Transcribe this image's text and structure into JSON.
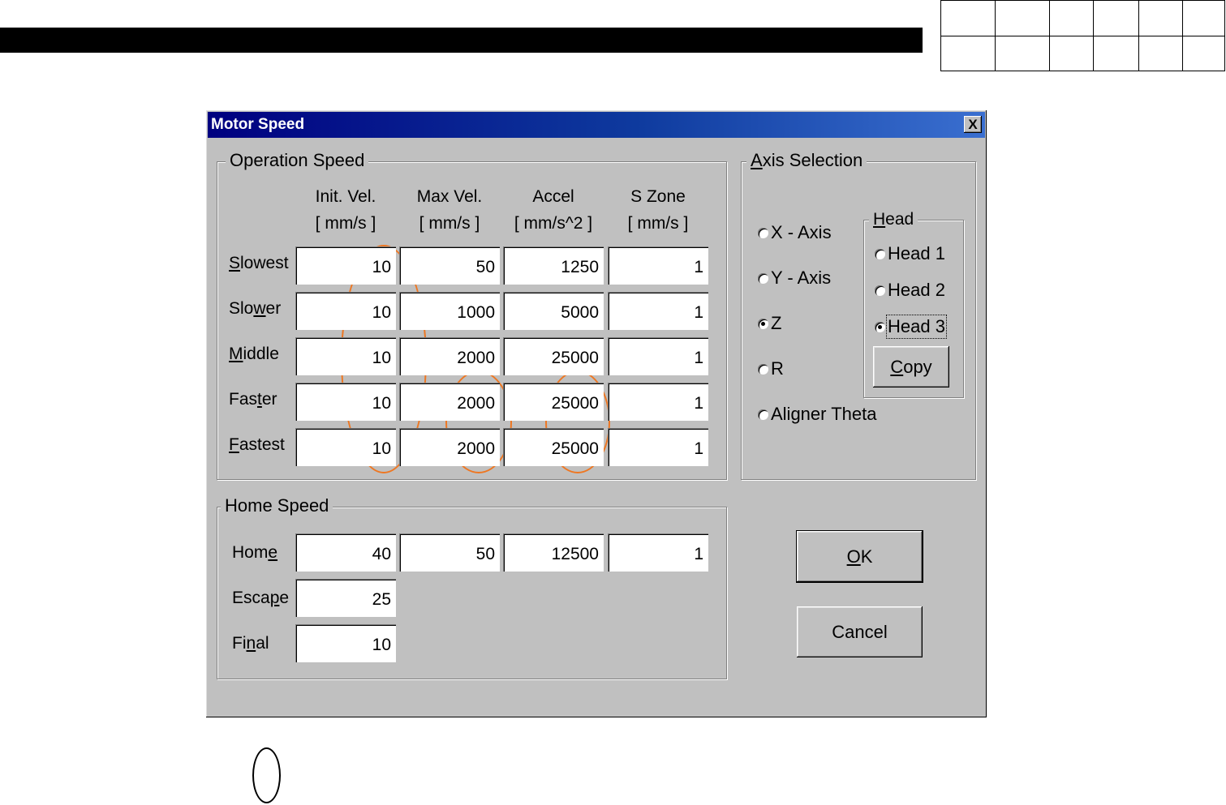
{
  "dialog": {
    "title": "Motor Speed",
    "close_label": "X"
  },
  "operation": {
    "group_label": "Operation Speed",
    "headers": [
      {
        "line1": "Init. Vel.",
        "line2": "[ mm/s ]"
      },
      {
        "line1": "Max Vel.",
        "line2": "[ mm/s ]"
      },
      {
        "line1": "Accel",
        "line2": "[ mm/s^2 ]"
      },
      {
        "line1": "S Zone",
        "line2": "[ mm/s ]"
      }
    ],
    "rows": [
      {
        "label": "Slowest",
        "mnemonic": "S",
        "values": [
          "10",
          "50",
          "1250",
          "1"
        ]
      },
      {
        "label": "Slower",
        "mnemonic": "w",
        "values": [
          "10",
          "1000",
          "5000",
          "1"
        ]
      },
      {
        "label": "Middle",
        "mnemonic": "M",
        "values": [
          "10",
          "2000",
          "25000",
          "1"
        ]
      },
      {
        "label": "Faster",
        "mnemonic": "t",
        "values": [
          "10",
          "2000",
          "25000",
          "1"
        ]
      },
      {
        "label": "Fastest",
        "mnemonic": "F",
        "values": [
          "10",
          "2000",
          "25000",
          "1"
        ]
      }
    ]
  },
  "home": {
    "group_label": "Home Speed",
    "rows": [
      {
        "label": "Home",
        "mnemonic": "e",
        "values": [
          "40",
          "50",
          "12500",
          "1"
        ]
      },
      {
        "label": "Escape",
        "mnemonic": "p",
        "values": [
          "25"
        ]
      },
      {
        "label": "Final",
        "mnemonic": "n",
        "values": [
          "10"
        ]
      }
    ]
  },
  "axis": {
    "group_label": "Axis Selection",
    "mnemonic": "A",
    "options": [
      {
        "label": "X - Axis",
        "selected": false
      },
      {
        "label": "Y - Axis",
        "selected": false
      },
      {
        "label": "Z",
        "selected": true
      },
      {
        "label": "R",
        "selected": false
      },
      {
        "label": "Aligner Theta",
        "selected": false
      }
    ]
  },
  "head": {
    "group_label": "Head",
    "mnemonic": "H",
    "options": [
      {
        "label": "Head 1",
        "selected": false
      },
      {
        "label": "Head 2",
        "selected": false
      },
      {
        "label": "Head 3",
        "selected": true
      }
    ],
    "copy_label": "Copy",
    "copy_mnemonic": "C"
  },
  "buttons": {
    "ok_label": "OK",
    "ok_mnemonic": "O",
    "cancel_label": "Cancel"
  },
  "annotation_color": "#ee7722"
}
